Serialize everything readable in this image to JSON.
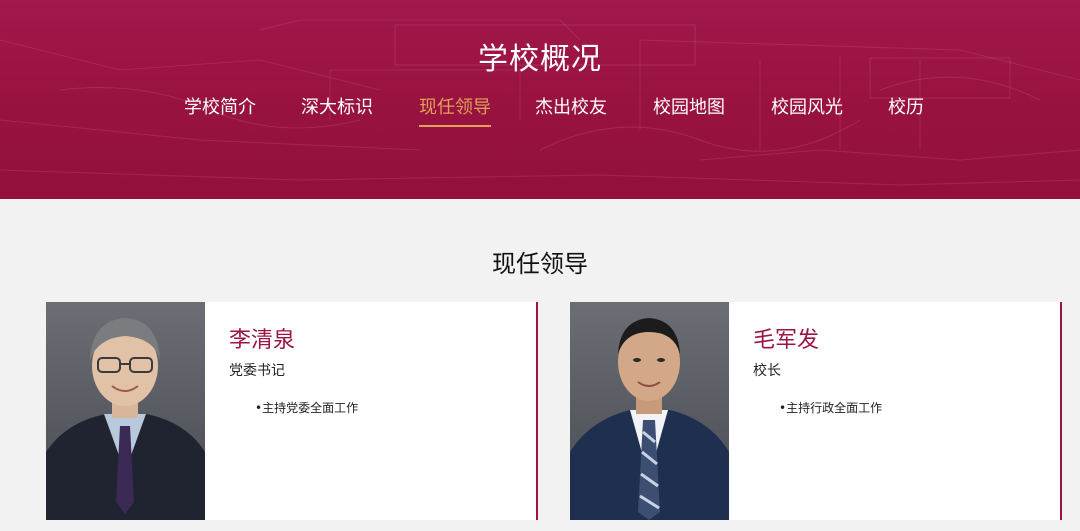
{
  "banner": {
    "title": "学校概况"
  },
  "nav": {
    "items": [
      {
        "label": "学校简介"
      },
      {
        "label": "深大标识"
      },
      {
        "label": "现任领导"
      },
      {
        "label": "杰出校友"
      },
      {
        "label": "校园地图"
      },
      {
        "label": "校园风光"
      },
      {
        "label": "校历"
      }
    ],
    "active": "现任领导"
  },
  "section": {
    "title": "现任领导"
  },
  "leaders": [
    {
      "name": "李清泉",
      "role": "党委书记",
      "duty": "•主持党委全面工作"
    },
    {
      "name": "毛军发",
      "role": "校长",
      "duty": "•主持行政全面工作"
    }
  ],
  "colors": {
    "banner": "#9b1446",
    "accent": "#e0a158",
    "name": "#9b1446",
    "background": "#f2f2f2"
  }
}
